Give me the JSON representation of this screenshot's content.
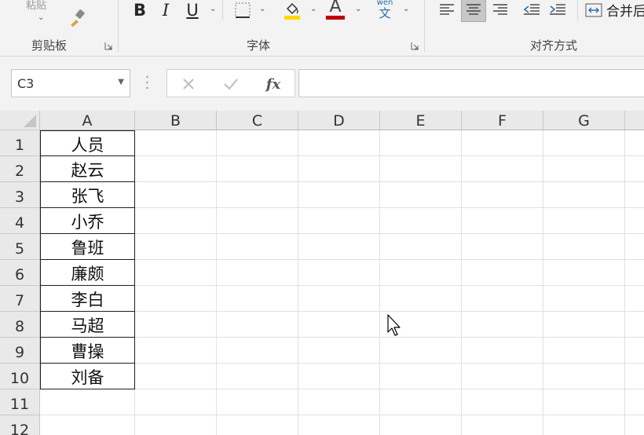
{
  "ribbon": {
    "paste_label": "粘贴",
    "groups": {
      "clipboard": "剪贴板",
      "font": "字体",
      "alignment": "对齐方式"
    },
    "font_buttons": {
      "bold": "B",
      "italic": "I",
      "underline": "U",
      "font_color_letter": "A",
      "phonetic_top": "wén",
      "phonetic_bottom": "文"
    },
    "merge_label": "合并后"
  },
  "formula_bar": {
    "name_box": "C3",
    "fx": "fx",
    "formula": ""
  },
  "sheet": {
    "columns": [
      "A",
      "B",
      "C",
      "D",
      "E",
      "F",
      "G"
    ],
    "rows": [
      "1",
      "2",
      "3",
      "4",
      "5",
      "6",
      "7",
      "8",
      "9",
      "10",
      "11",
      "12"
    ],
    "column_a": [
      "人员",
      "赵云",
      "张飞",
      "小乔",
      "鲁班",
      "廉颇",
      "李白",
      "马超",
      "曹操",
      "刘备"
    ]
  },
  "colors": {
    "highlight_yellow": "#ffd700",
    "font_red": "#c00000",
    "phonetic_blue": "#2b6cb0"
  }
}
